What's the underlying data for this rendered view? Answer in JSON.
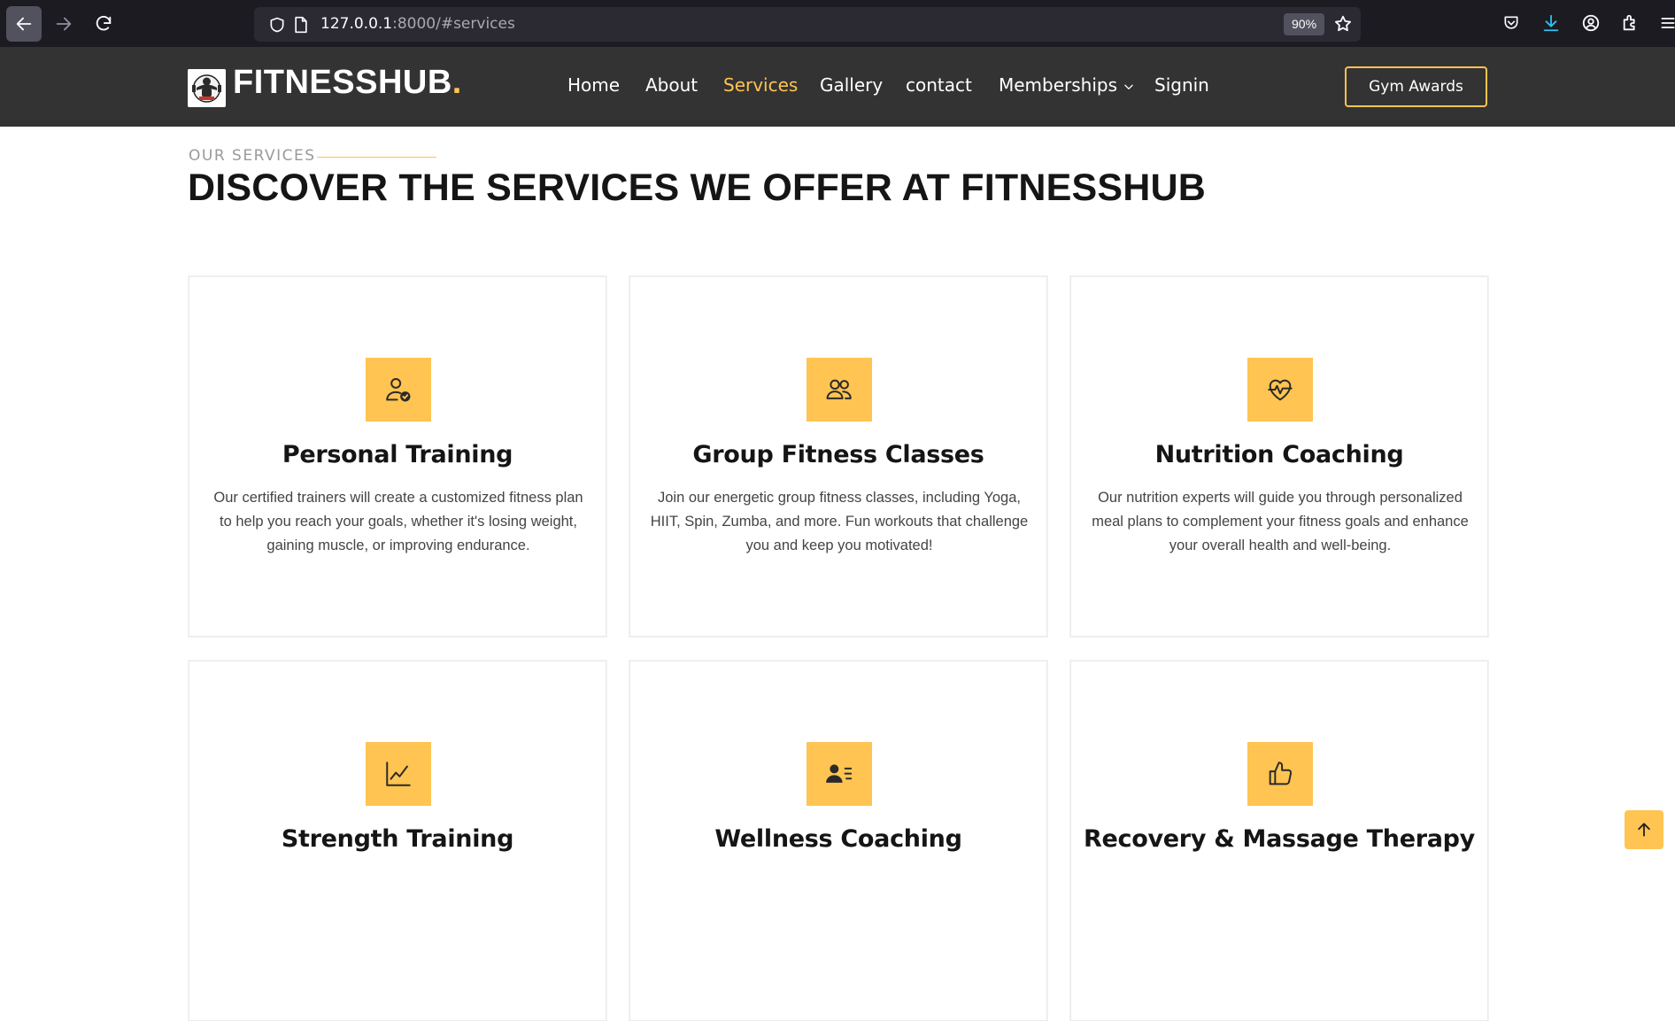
{
  "browser": {
    "url_host": "127.0.0.1",
    "url_rest": ":8000/#services",
    "zoom": "90%"
  },
  "site": {
    "logo_text": "FITNESSHUB",
    "logo_dot": ".",
    "nav": {
      "home": "Home",
      "about": "About",
      "services": "Services",
      "gallery": "Gallery",
      "contact": "contact",
      "memberships": "Memberships",
      "signin": "Signin"
    },
    "cta": "Gym Awards"
  },
  "section": {
    "subtitle": "OUR SERVICES",
    "title": "DISCOVER THE SERVICES WE OFFER AT FITNESSHUB"
  },
  "services": [
    {
      "icon": "person-check-icon",
      "title": "Personal Training",
      "desc": "Our certified trainers will create a customized fitness plan to help you reach your goals, whether it's losing weight, gaining muscle, or improving endurance."
    },
    {
      "icon": "people-icon",
      "title": "Group Fitness Classes",
      "desc": "Join our energetic group fitness classes, including Yoga, HIIT, Spin, Zumba, and more. Fun workouts that challenge you and keep you motivated!"
    },
    {
      "icon": "heart-pulse-icon",
      "title": "Nutrition Coaching",
      "desc": "Our nutrition experts will guide you through personalized meal plans to complement your fitness goals and enhance your overall health and well-being."
    },
    {
      "icon": "graph-up-icon",
      "title": "Strength Training",
      "desc": ""
    },
    {
      "icon": "person-lines-icon",
      "title": "Wellness Coaching",
      "desc": ""
    },
    {
      "icon": "hand-thumbs-up-icon",
      "title": "Recovery & Massage Therapy",
      "desc": ""
    }
  ],
  "colors": {
    "accent": "#ffc451",
    "header_bg": "#333333",
    "browser_bg": "#1c1b22"
  }
}
